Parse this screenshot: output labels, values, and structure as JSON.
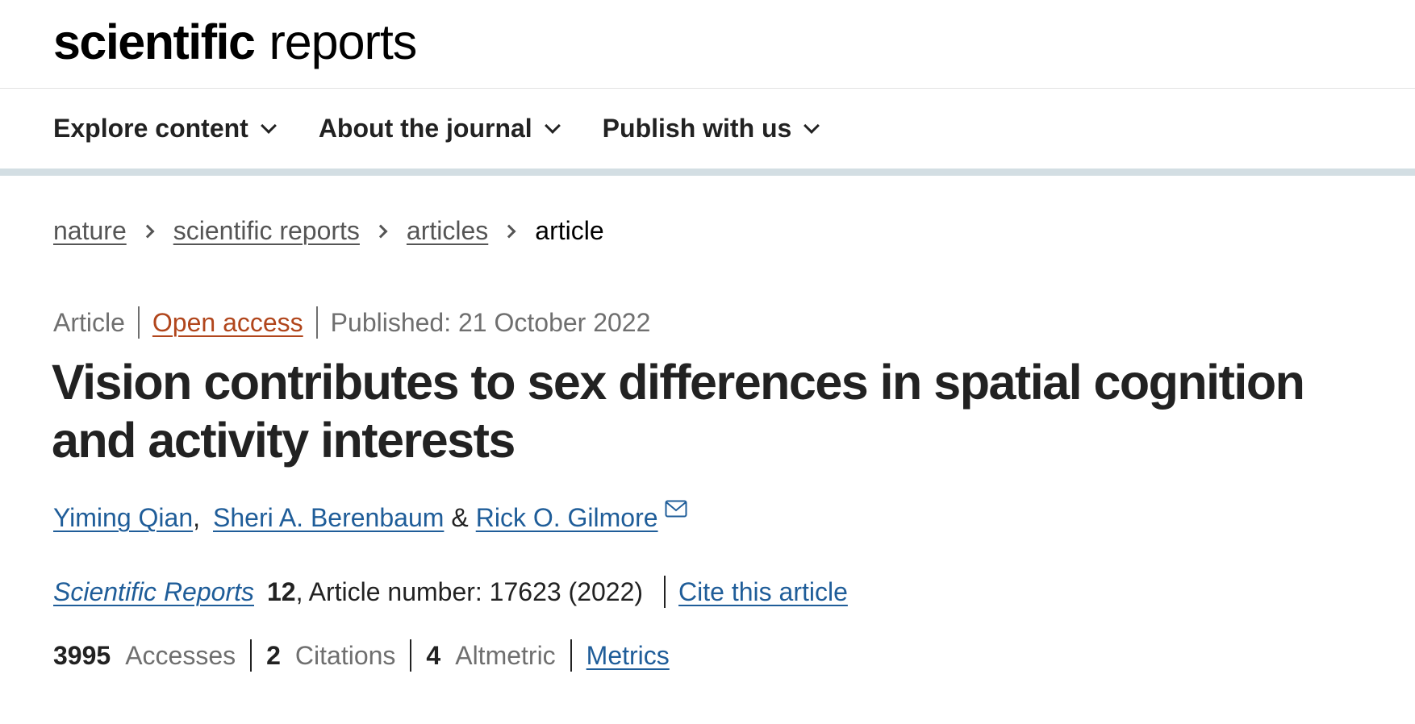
{
  "header": {
    "logo_bold": "scientific",
    "logo_light": "reports"
  },
  "nav": {
    "items": [
      {
        "label": "Explore content",
        "icon": "chevron-down-icon"
      },
      {
        "label": "About the journal",
        "icon": "chevron-down-icon"
      },
      {
        "label": "Publish with us",
        "icon": "chevron-down-icon"
      }
    ]
  },
  "breadcrumb": {
    "items": [
      "nature",
      "scientific reports",
      "articles",
      "article"
    ]
  },
  "article": {
    "type": "Article",
    "access": "Open access",
    "published": "Published: 21 October 2022",
    "title": "Vision contributes to sex differences in spatial cognition and activity interests",
    "authors": [
      "Yiming Qian",
      "Sheri A. Berenbaum",
      "Rick O. Gilmore"
    ],
    "author_sep_1": ",",
    "author_sep_2": "&",
    "journal": "Scientific Reports",
    "volume": "12",
    "article_number": ", Article number: 17623 (2022)",
    "cite_label": "Cite this article"
  },
  "metrics": {
    "accesses_value": "3995",
    "accesses_label": "Accesses",
    "citations_value": "2",
    "citations_label": "Citations",
    "altmetric_value": "4",
    "altmetric_label": "Altmetric",
    "metrics_link": "Metrics"
  },
  "colors": {
    "link": "#1f5d99",
    "open_access": "#b1461c",
    "nav_border": "#d3dee3"
  }
}
